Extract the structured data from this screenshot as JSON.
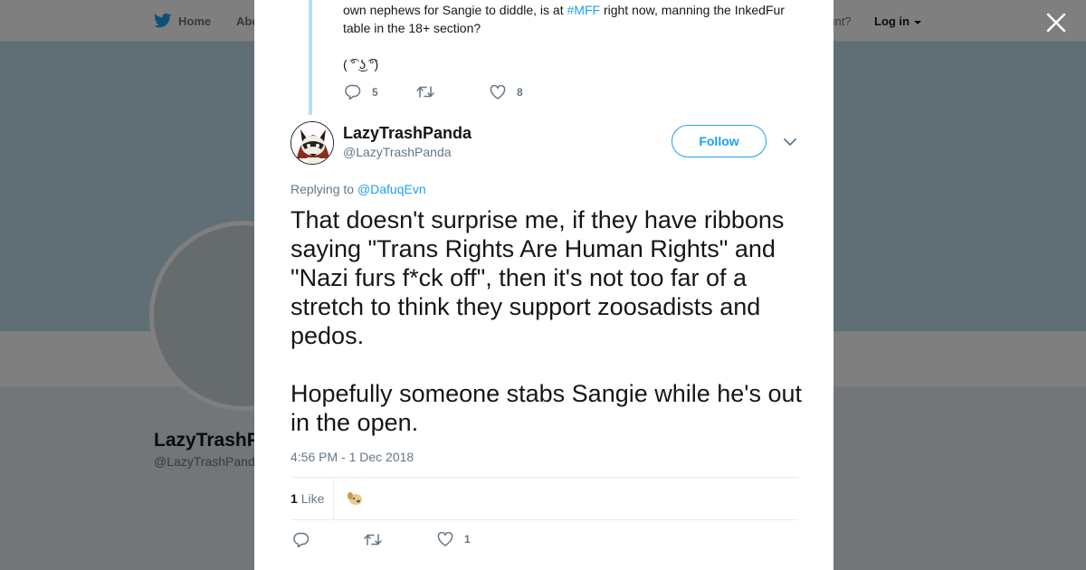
{
  "nav": {
    "home_label": "Home",
    "about_label": "Abo",
    "account_prompt": "ccount?",
    "login_label": "Log in"
  },
  "profile": {
    "name": "LazyTrashP",
    "handle": "@LazyTrashPand"
  },
  "previous_tweet": {
    "text_before": "own nephews for Sangie to diddle, is at ",
    "hashtag": "#MFF",
    "text_after": " right now, manning the InkedFur table in the 18+ section?",
    "face": "( ͡° ͜ʖ ͡°)",
    "reply_count": "5",
    "like_count": "8"
  },
  "tweet": {
    "author_name": "LazyTrashPanda",
    "author_handle": "@LazyTrashPanda",
    "follow_label": "Follow",
    "replying_prefix": "Replying to ",
    "replying_to": "@DafuqEvn",
    "text_p1": "That doesn't surprise me, if they have ribbons saying \"Trans Rights Are Human Rights\" and \"Nazi furs f*ck off\", then it's not too far of a stretch to think they support zoosadists and pedos.",
    "text_p2": "Hopefully someone stabs Sangie while he's out in the open.",
    "timestamp": "4:56 PM - 1 Dec 2018",
    "stat_like_number": "1",
    "stat_like_word": "Like",
    "like_count": "1"
  },
  "colors": {
    "accent": "#1da1f2",
    "thread_line": "#b9dcf3",
    "muted": "#657786"
  },
  "icons": [
    "twitter-bird-icon",
    "close-icon",
    "reply-icon",
    "retweet-icon",
    "heart-icon",
    "chevron-down-icon",
    "caret-down-icon"
  ]
}
